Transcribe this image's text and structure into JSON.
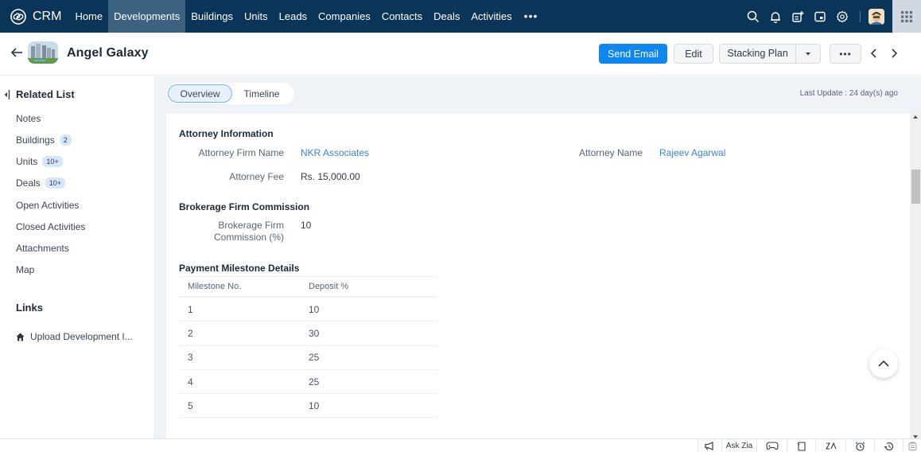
{
  "topnav": {
    "brand": "CRM",
    "tabs": [
      {
        "label": "Home",
        "active": false
      },
      {
        "label": "Developments",
        "active": true
      },
      {
        "label": "Buildings",
        "active": false
      },
      {
        "label": "Units",
        "active": false
      },
      {
        "label": "Leads",
        "active": false
      },
      {
        "label": "Companies",
        "active": false
      },
      {
        "label": "Contacts",
        "active": false
      },
      {
        "label": "Deals",
        "active": false
      },
      {
        "label": "Activities",
        "active": false
      }
    ],
    "more": "•••",
    "icons": [
      "search-icon",
      "bell-icon",
      "add-note-icon",
      "calendar-icon",
      "gear-icon",
      "avatar",
      "app-grid-icon"
    ]
  },
  "record": {
    "title": "Angel Galaxy",
    "buttons": {
      "send_email": "Send Email",
      "edit": "Edit",
      "stacking_plan": "Stacking Plan",
      "more": "•••"
    }
  },
  "sidebar": {
    "title": "Related List",
    "items": [
      {
        "label": "Notes",
        "badge": null
      },
      {
        "label": "Buildings",
        "badge": "2"
      },
      {
        "label": "Units",
        "badge": "10+"
      },
      {
        "label": "Deals",
        "badge": "10+"
      },
      {
        "label": "Open Activities",
        "badge": null
      },
      {
        "label": "Closed Activities",
        "badge": null
      },
      {
        "label": "Attachments",
        "badge": null
      },
      {
        "label": "Map",
        "badge": null
      }
    ],
    "links_title": "Links",
    "links": [
      {
        "label": "Upload Development I...",
        "icon": "home-icon"
      }
    ]
  },
  "main": {
    "tabs": [
      {
        "label": "Overview",
        "active": true
      },
      {
        "label": "Timeline",
        "active": false
      }
    ],
    "last_update": "Last Update : 24 day(s) ago",
    "sections": {
      "attorney": {
        "title": "Attorney Information",
        "firm_name_label": "Attorney Firm Name",
        "firm_name_value": "NKR Associates",
        "attorney_name_label": "Attorney Name",
        "attorney_name_value": "Rajeev Agarwal",
        "fee_label": "Attorney Fee",
        "fee_value": "Rs. 15,000.00"
      },
      "brokerage": {
        "title": "Brokerage Firm Commission",
        "commission_label_line1": "Brokerage Firm",
        "commission_label_line2": "Commission (%)",
        "commission_value": "10"
      },
      "milestones": {
        "title": "Payment Milestone Details",
        "columns": [
          "Milestone No.",
          "Deposit %"
        ],
        "rows": [
          [
            "1",
            "10"
          ],
          [
            "2",
            "30"
          ],
          [
            "3",
            "25"
          ],
          [
            "4",
            "25"
          ],
          [
            "5",
            "10"
          ]
        ]
      }
    }
  },
  "bottombar": {
    "ask_zia": "Ask Zia",
    "icons": [
      "announcement-icon",
      "ask-zia",
      "gamepad-icon",
      "notes-icon",
      "zia-icon",
      "alarm-clock-icon",
      "history-icon",
      "files-icon"
    ]
  }
}
